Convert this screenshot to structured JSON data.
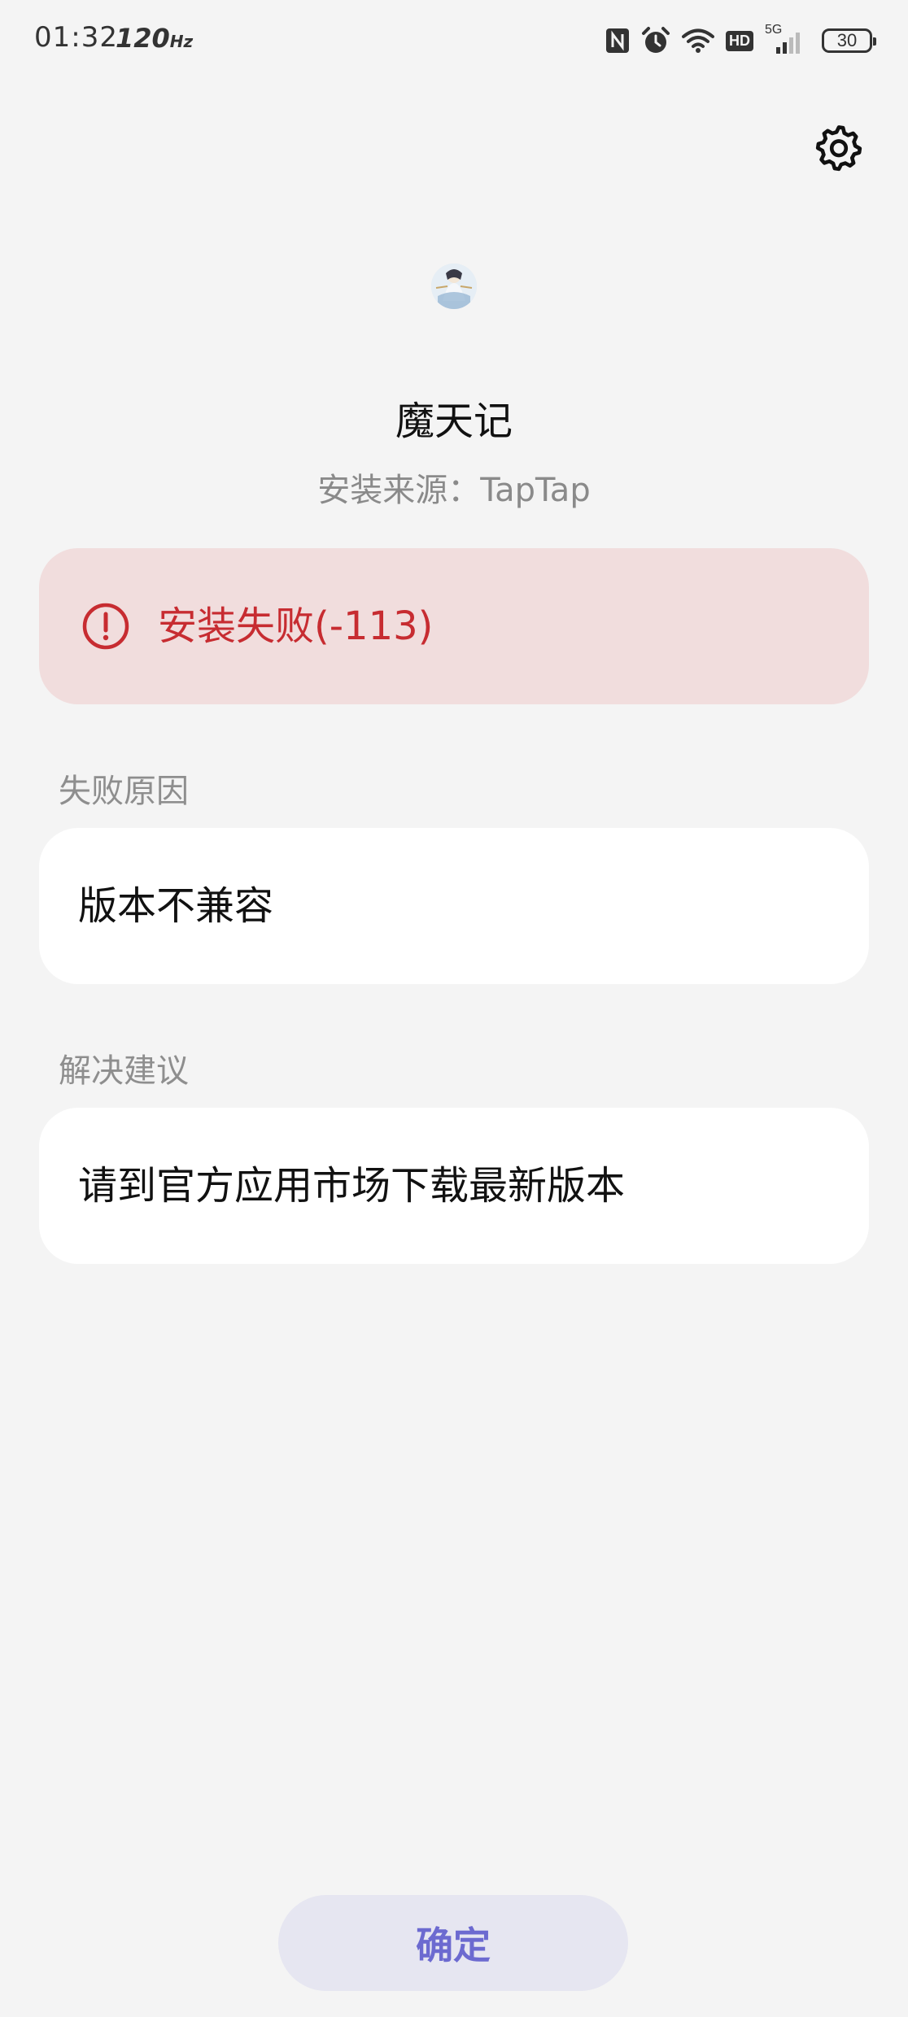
{
  "status_bar": {
    "time": "01:32",
    "refresh_rate": "120",
    "refresh_unit": "Hz",
    "network_hd": "HD",
    "network_type": "5G",
    "battery": "30"
  },
  "app": {
    "name": "魔天记",
    "install_source": "安装来源：TapTap"
  },
  "error": {
    "message": "安装失败(-113)",
    "color": "#c72c31",
    "background": "#f1dddd"
  },
  "failure": {
    "label": "失败原因",
    "reason": "版本不兼容"
  },
  "suggestion": {
    "label": "解决建议",
    "text": "请到官方应用市场下载最新版本"
  },
  "confirm_button": {
    "label": "确定",
    "color": "#6c6ad0"
  },
  "icons": {
    "settings": "gear-icon",
    "error": "exclamation-circle-icon",
    "nfc": "nfc-icon",
    "alarm": "alarm-icon",
    "wifi": "wifi-icon",
    "signal": "signal-icon"
  }
}
